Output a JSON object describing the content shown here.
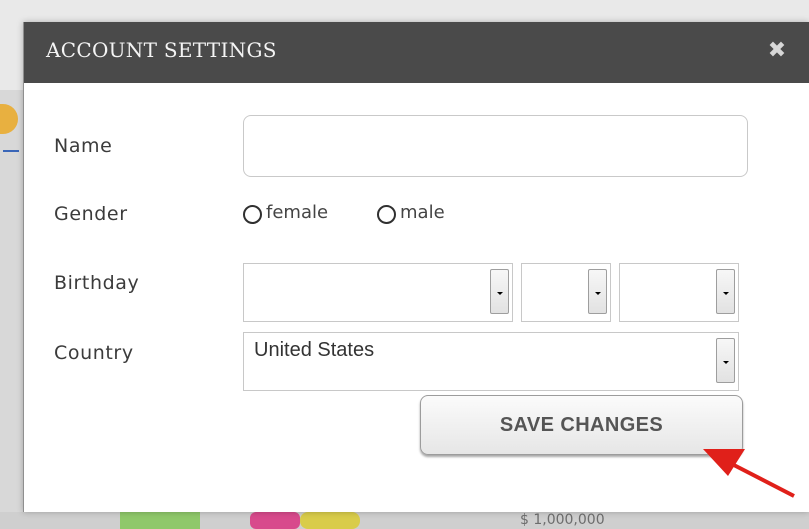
{
  "dialog": {
    "title": "ACCOUNT SETTINGS",
    "close_glyph": "✖"
  },
  "form": {
    "name": {
      "label": "Name",
      "value": "",
      "placeholder": ""
    },
    "gender": {
      "label": "Gender",
      "options": [
        {
          "label": "female",
          "checked": false
        },
        {
          "label": "male",
          "checked": false
        }
      ]
    },
    "birthday": {
      "label": "Birthday",
      "month": "",
      "day": "",
      "year": ""
    },
    "country": {
      "label": "Country",
      "value": "United States"
    },
    "save_label": "SAVE CHANGES"
  },
  "background": {
    "amount_text": "$ 1,000,000"
  },
  "colors": {
    "header_bg": "#4a4a4a",
    "annotation_arrow": "#e0201a"
  },
  "icons": {
    "close": "close-icon",
    "dropdown": "chevron-down-icon",
    "annotation": "arrow-pointer-icon"
  }
}
